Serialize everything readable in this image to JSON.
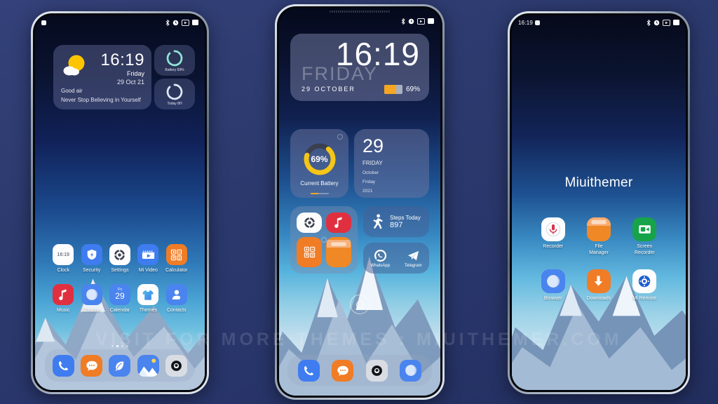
{
  "watermark": "VISIT FOR MORE THEMES : MIUITHEMER.COM",
  "colors": {
    "page_bg": "#2c3a6e",
    "accent_orange": "#f5a623",
    "accent_teal": "#8fe3d5",
    "widget_panel": "#6e76a0"
  },
  "phone1": {
    "statusbar": {
      "time": "",
      "icons": [
        "bluetooth-icon",
        "alarm-icon",
        "screenshot-icon",
        "battery-icon"
      ]
    },
    "weather_widget": {
      "time": "16:19",
      "day": "Friday",
      "date": "29 Oct 21",
      "air_quality": "Good air",
      "quote": "Never Stop Believing in Yourself",
      "weather_icon": "sun-cloud-icon"
    },
    "side_widgets": [
      {
        "label": "Battery 69%",
        "icon": "battery-ring-icon",
        "percent": 69
      },
      {
        "label": "Today 8H",
        "icon": "usage-ring-icon",
        "percent": 62
      }
    ],
    "apps_row1": [
      {
        "label": "Clock",
        "icon": "clock-icon",
        "icon_text": "16:19"
      },
      {
        "label": "Security",
        "icon": "security-shield-icon"
      },
      {
        "label": "Settings",
        "icon": "settings-gear-icon"
      },
      {
        "label": "Mi Video",
        "icon": "mi-video-icon"
      },
      {
        "label": "Calculator",
        "icon": "calculator-icon"
      }
    ],
    "apps_row2": [
      {
        "label": "Music",
        "icon": "music-note-icon"
      },
      {
        "label": "Chrome",
        "icon": "chrome-icon"
      },
      {
        "label": "Calendar",
        "icon": "calendar-icon",
        "weekday": "Fri",
        "day": "29"
      },
      {
        "label": "Themes",
        "icon": "themes-shirt-icon"
      },
      {
        "label": "Contacts",
        "icon": "contacts-person-icon"
      }
    ],
    "page_dots": {
      "count": 4,
      "active_index": 1
    },
    "dock": [
      {
        "label": "Phone",
        "icon": "phone-handset-icon"
      },
      {
        "label": "Messages",
        "icon": "message-bubble-icon"
      },
      {
        "label": "Notes",
        "icon": "notes-leaf-icon"
      },
      {
        "label": "Gallery",
        "icon": "gallery-photo-icon"
      },
      {
        "label": "Camera",
        "icon": "camera-lens-icon"
      }
    ]
  },
  "phone2": {
    "statusbar": {
      "time": "",
      "icons": [
        "bluetooth-icon",
        "alarm-icon",
        "screenshot-icon",
        "battery-icon"
      ]
    },
    "clock_widget": {
      "time": "16:19",
      "weekday": "FRIDAY",
      "date": "29 OCTOBER",
      "battery_percent": "69%",
      "battery_level": 69
    },
    "battery_widget": {
      "percent": "69%",
      "value": 69,
      "caption": "Current Battery"
    },
    "date_widget": {
      "day": "29",
      "weekday": "FRIDAY",
      "month": "October",
      "weekday2": "Friday",
      "year": "2021"
    },
    "folder_apps": [
      {
        "label": "Settings",
        "icon": "settings-gear-icon"
      },
      {
        "label": "Music",
        "icon": "music-note-icon"
      },
      {
        "label": "Calculator",
        "icon": "calculator-icon"
      },
      {
        "label": "File Manager",
        "icon": "file-manager-icon"
      }
    ],
    "steps_widget": {
      "title": "Steps Today",
      "value": "897",
      "icon": "walking-person-icon"
    },
    "chat_widget": [
      {
        "label": "WhatsApp",
        "icon": "whatsapp-icon"
      },
      {
        "label": "Telegram",
        "icon": "telegram-icon"
      }
    ],
    "home_indicator": "home-circle-icon",
    "dock": [
      {
        "label": "Phone",
        "icon": "phone-handset-icon"
      },
      {
        "label": "Messages",
        "icon": "message-bubble-icon"
      },
      {
        "label": "Camera",
        "icon": "camera-lens-icon"
      },
      {
        "label": "Chrome",
        "icon": "chrome-icon"
      }
    ]
  },
  "phone3": {
    "statusbar": {
      "time": "16:19",
      "icons": [
        "bluetooth-icon",
        "alarm-icon",
        "screenshot-icon",
        "battery-icon"
      ]
    },
    "title": "Miuithemer",
    "apps": [
      {
        "label": "Recorder",
        "icon": "recorder-mic-icon"
      },
      {
        "label": "File\nManager",
        "icon": "file-manager-icon"
      },
      {
        "label": "Screen\nRecorder",
        "icon": "screen-recorder-icon"
      },
      {
        "label": "Browser",
        "icon": "browser-icon"
      },
      {
        "label": "Downloads",
        "icon": "downloads-arrow-icon"
      },
      {
        "label": "Mi Remote",
        "icon": "mi-remote-icon"
      }
    ]
  }
}
